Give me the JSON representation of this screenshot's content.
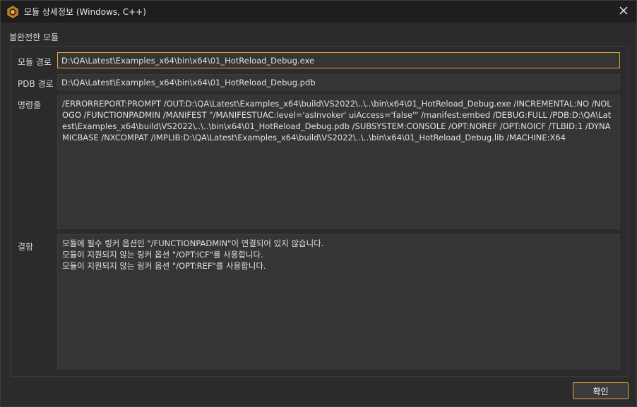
{
  "window": {
    "title": "모듈 상세정보 (Windows, C++)",
    "icon": "app-logo-icon",
    "close_icon": "close-icon"
  },
  "group": {
    "title": "불완전한 모듈"
  },
  "fields": {
    "module_path_label": "모듈 경로",
    "module_path_value": "D:\\QA\\Latest\\Examples_x64\\bin\\x64\\01_HotReload_Debug.exe",
    "pdb_path_label": "PDB 경로",
    "pdb_path_value": "D:\\QA\\Latest\\Examples_x64\\bin\\x64\\01_HotReload_Debug.pdb",
    "command_label": "명령줄",
    "command_value": " /ERRORREPORT:PROMPT /OUT:D:\\QA\\Latest\\Examples_x64\\build\\VS2022\\..\\..\\bin\\x64\\01_HotReload_Debug.exe /INCREMENTAL:NO /NOLOGO /FUNCTIONPADMIN /MANIFEST \"/MANIFESTUAC:level='asInvoker' uiAccess='false'\" /manifest:embed /DEBUG:FULL /PDB:D:\\QA\\Latest\\Examples_x64\\build\\VS2022\\..\\..\\bin\\x64\\01_HotReload_Debug.pdb /SUBSYSTEM:CONSOLE /OPT:NOREF /OPT:NOICF /TLBID:1 /DYNAMICBASE /NXCOMPAT /IMPLIB:D:\\QA\\Latest\\Examples_x64\\build\\VS2022\\..\\..\\bin\\x64\\01_HotReload_Debug.lib /MACHINE:X64",
    "defects_label": "결함",
    "defects": [
      "모듈에 필수 링커 옵션인 \"/FUNCTIONPADMIN\"이 연결되어 있지 않습니다.",
      "모듈이 지원되지 않는 링커 옵션 \"/OPT:ICF\"를 사용합니다.",
      "모듈이 지원되지 않는 링커 옵션 \"/OPT:REF\"를 사용합니다."
    ]
  },
  "buttons": {
    "ok_label": "확인"
  },
  "colors": {
    "background": "#2b2b2b",
    "titlebar": "#1e1e1e",
    "field_bg": "#353535",
    "accent": "#e8a23a"
  }
}
